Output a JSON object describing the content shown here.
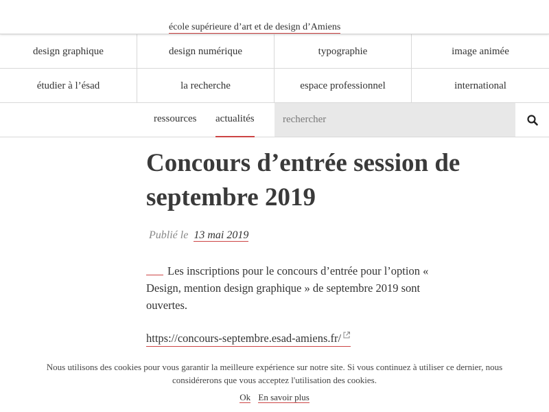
{
  "header": {
    "site_title": "école supérieure d’art et de design d’Amiens"
  },
  "nav": {
    "row1": [
      "design graphique",
      "design numérique",
      "typographie",
      "image animée"
    ],
    "row2": [
      "étudier à l’ésad",
      "la recherche",
      "espace professionnel",
      "international"
    ],
    "ressources": "ressources",
    "actualites": "actualités",
    "search_placeholder": "rechercher",
    "search_icon": "search-icon"
  },
  "article": {
    "title": "Concours d’entrée session de septembre 2019",
    "published_label": "Publié le",
    "published_date": "13 mai 2019",
    "body": "Les inscriptions pour le concours d’entrée pour l’option « Design, mention design graphique » de septembre 2019 sont ouvertes.",
    "link": "https://concours-septembre.esad-amiens.fr/",
    "link_icon": "external-link-icon"
  },
  "cookie": {
    "text": "Nous utilisons des cookies pour vous garantir la meilleure expérience sur notre site. Si vous continuez à utiliser ce dernier, nous considérerons que vous acceptez l'utilisation des cookies.",
    "ok_label": "Ok",
    "more_label": "En savoir plus"
  },
  "colors": {
    "accent": "#cc4444",
    "text": "#333333",
    "search_bg": "#e8e8e8"
  }
}
